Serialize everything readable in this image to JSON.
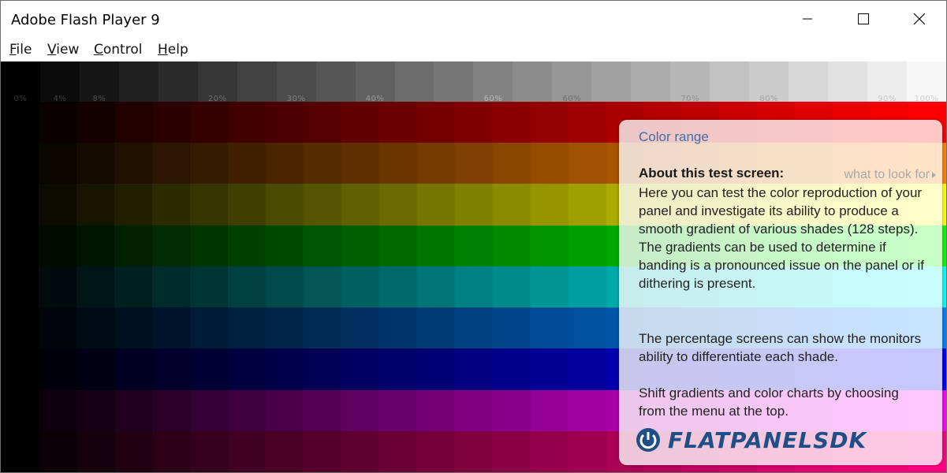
{
  "window": {
    "title": "Adobe Flash Player 9"
  },
  "controls": {
    "minimize": "minimize-icon",
    "maximize": "maximize-icon",
    "close": "close-icon"
  },
  "menu": [
    {
      "label": "File",
      "key": "F",
      "rest": "ile"
    },
    {
      "label": "View",
      "key": "V",
      "rest": "iew"
    },
    {
      "label": "Control",
      "key": "C",
      "rest": "ontrol"
    },
    {
      "label": "Help",
      "key": "H",
      "rest": "elp"
    }
  ],
  "grayscale": {
    "labels": [
      "0%",
      "4%",
      "8%",
      "",
      "",
      "20%",
      "",
      "30%",
      "",
      "40%",
      "",
      "",
      "60%",
      "",
      "60%",
      "",
      "",
      "70%",
      "",
      "80%",
      "",
      "",
      "90%",
      "100%"
    ]
  },
  "color_bands": [
    "#ff0000",
    "#ff8000",
    "#ffff00",
    "#00ff00",
    "#00ffff",
    "#0080ff",
    "#0000ff",
    "#ff00ff",
    "#ff0080"
  ],
  "panel": {
    "title": "Color range",
    "link": "what to look for",
    "heading": "About this test screen:",
    "paragraph1": "Here you can test the color reproduction of your panel and investigate its ability to produce a smooth gradient of various shades (128 steps). The gradients can be used to determine if banding is a pronounced issue on the panel or if dithering is present.",
    "paragraph2": "The percentage screens can show the monitors ability to differentiate each shade.",
    "paragraph3": "Shift gradients and color charts by choosing from the menu at the top.",
    "logo": "FLATPANELSDK"
  },
  "colors": {
    "panel_title": "#3f6fa8",
    "logo": "#1f4f86"
  }
}
